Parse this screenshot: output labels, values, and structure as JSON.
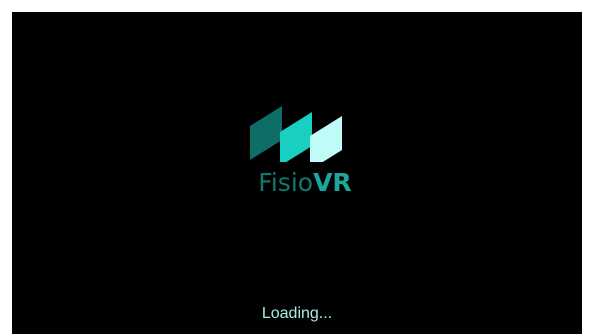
{
  "app": {
    "brand_part1": "Fisio",
    "brand_part2": "VR"
  },
  "status": {
    "loading_text": "Loading..."
  },
  "colors": {
    "background": "#000000",
    "frame": "#ffffff",
    "stripe_dark": "#0e6e66",
    "stripe_mid": "#19d0c0",
    "stripe_light": "#bffcf8",
    "wordmark_normal": "#0f7a72",
    "wordmark_bold": "#1aa89c",
    "loading_text": "#a8ece6"
  },
  "icons": {
    "logo": "fisiovr-logo-icon"
  }
}
